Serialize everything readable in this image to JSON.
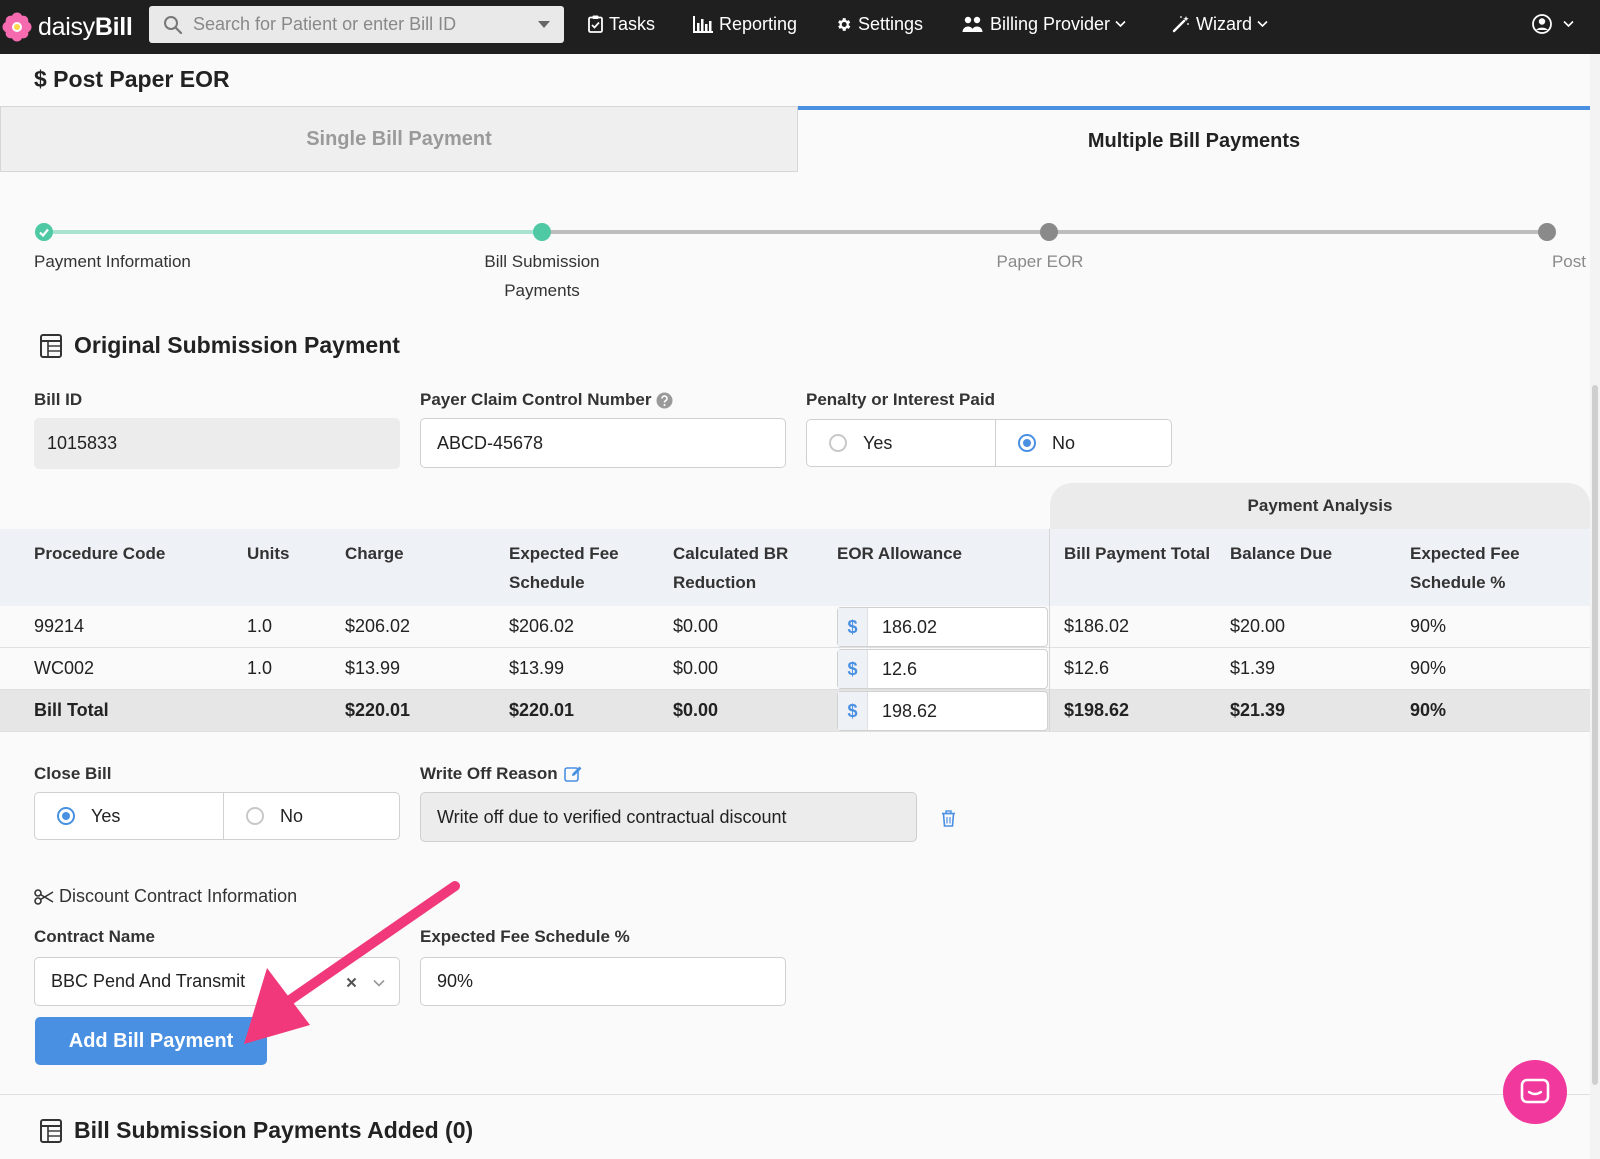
{
  "nav": {
    "logo_light": "daisy",
    "logo_bold": "Bill",
    "search_placeholder": "Search for Patient or enter Bill ID",
    "tasks": "Tasks",
    "reporting": "Reporting",
    "settings": "Settings",
    "billing_provider": "Billing Provider",
    "wizard": "Wizard"
  },
  "page": {
    "title": "$ Post Paper EOR",
    "tabs": [
      "Single Bill Payment",
      "Multiple Bill Payments"
    ],
    "active_tab": "Multiple Bill Payments"
  },
  "stepper": {
    "steps": [
      {
        "label_1": "Payment Information",
        "label_2": "",
        "state": "complete"
      },
      {
        "label_1": "Bill Submission",
        "label_2": "Payments",
        "state": "active"
      },
      {
        "label_1": "Paper EOR",
        "label_2": "",
        "state": "pending"
      },
      {
        "label_1": "Post",
        "label_2": "",
        "state": "pending"
      }
    ]
  },
  "original": {
    "title": "Original Submission Payment",
    "bill_id_label": "Bill ID",
    "bill_id": "1015833",
    "pccn_label": "Payer Claim Control Number",
    "pccn": "ABCD-45678",
    "penalty_label": "Penalty or Interest Paid",
    "penalty_yes": "Yes",
    "penalty_no": "No",
    "penalty_selected": "No"
  },
  "table": {
    "payment_analysis": "Payment Analysis",
    "headers": {
      "procedure_code": "Procedure Code",
      "units": "Units",
      "charge": "Charge",
      "efs_1": "Expected Fee",
      "efs_2": "Schedule",
      "br_1": "Calculated BR",
      "br_2": "Reduction",
      "eor": "EOR Allowance",
      "bpt": "Bill Payment Total",
      "balance": "Balance Due",
      "efsp_1": "Expected Fee",
      "efsp_2": "Schedule %"
    },
    "currency": "$",
    "rows": [
      {
        "code": "99214",
        "units": "1.0",
        "charge": "$206.02",
        "efs": "$206.02",
        "br": "$0.00",
        "eor": "186.02",
        "bpt": "$186.02",
        "balance": "$20.00",
        "efsp": "90%"
      },
      {
        "code": "WC002",
        "units": "1.0",
        "charge": "$13.99",
        "efs": "$13.99",
        "br": "$0.00",
        "eor": "12.6",
        "bpt": "$12.6",
        "balance": "$1.39",
        "efsp": "90%"
      }
    ],
    "total": {
      "label": "Bill Total",
      "charge": "$220.01",
      "efs": "$220.01",
      "br": "$0.00",
      "eor": "198.62",
      "bpt": "$198.62",
      "balance": "$21.39",
      "efsp": "90%"
    }
  },
  "close_bill": {
    "label": "Close Bill",
    "yes": "Yes",
    "no": "No",
    "selected": "Yes",
    "write_off_label": "Write Off Reason",
    "write_off_value": "Write off due to verified contractual discount"
  },
  "discount": {
    "title": "Discount Contract Information",
    "contract_label": "Contract Name",
    "contract_value": "BBC Pend And Transmit",
    "efs_label": "Expected Fee Schedule %",
    "efs_value": "90%"
  },
  "actions": {
    "add_payment": "Add Bill Payment"
  },
  "added": {
    "title": "Bill Submission Payments Added (0)"
  },
  "colors": {
    "accent": "#4a90e2",
    "step_complete": "#4fc9a4",
    "annotation_arrow": "#f0387a",
    "chat": "#f0389d"
  }
}
